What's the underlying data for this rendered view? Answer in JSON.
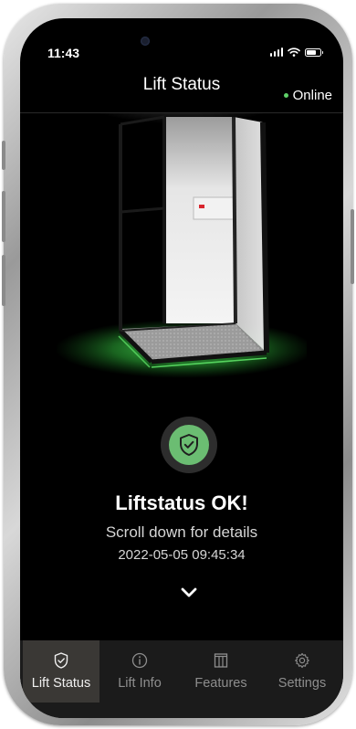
{
  "status_bar": {
    "time": "11:43",
    "signal_icon": "signal-bars-icon",
    "wifi_icon": "wifi-icon",
    "battery_icon": "battery-icon"
  },
  "header": {
    "title": "Lift Status",
    "connection_status": "Online",
    "connection_color": "#5fd168"
  },
  "main": {
    "hero_image": "glass-lift-cabin",
    "status_icon": "shield-check-icon",
    "status_color": "#6bbd72",
    "glow_color": "#4fe05a",
    "status_title": "Liftstatus OK!",
    "status_subtitle": "Scroll down for details",
    "status_timestamp": "2022-05-05 09:45:34",
    "scroll_icon": "chevron-down-icon"
  },
  "tabbar": {
    "tabs": [
      {
        "label": "Lift Status",
        "icon": "shield-check-icon",
        "active": true
      },
      {
        "label": "Lift Info",
        "icon": "info-icon",
        "active": false
      },
      {
        "label": "Features",
        "icon": "features-icon",
        "active": false
      },
      {
        "label": "Settings",
        "icon": "gear-icon",
        "active": false
      }
    ]
  }
}
